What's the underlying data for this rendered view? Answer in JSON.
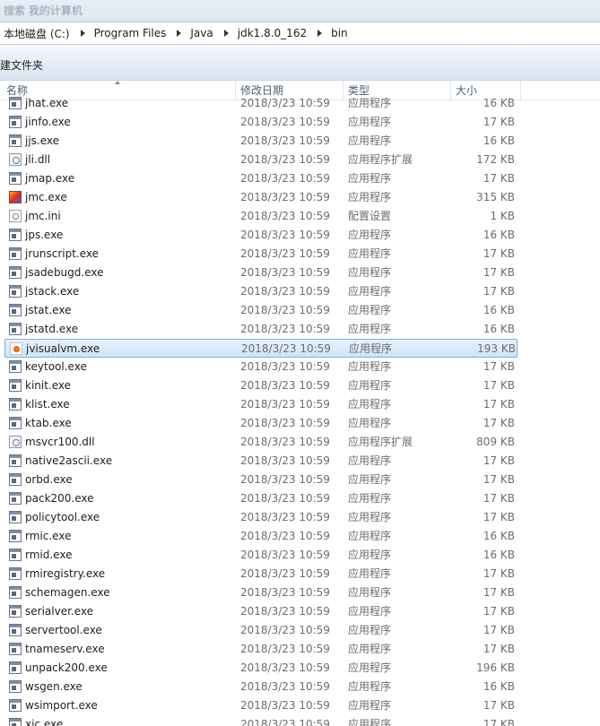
{
  "window": {
    "title_fragment": "搜索 我的计算机"
  },
  "address": {
    "crumbs": [
      "本地磁盘 (C:)",
      "Program Files",
      "Java",
      "jdk1.8.0_162",
      "bin"
    ]
  },
  "toolbar": {
    "new_folder_label": "新建文件夹"
  },
  "columns": {
    "name": "名称",
    "modified": "修改日期",
    "type": "类型",
    "size": "大小"
  },
  "files": [
    {
      "name": "jhat.exe",
      "date": "2018/3/23 10:59",
      "type": "应用程序",
      "size": "16 KB",
      "icon": "exe-icon"
    },
    {
      "name": "jinfo.exe",
      "date": "2018/3/23 10:59",
      "type": "应用程序",
      "size": "17 KB",
      "icon": "exe-icon"
    },
    {
      "name": "jjs.exe",
      "date": "2018/3/23 10:59",
      "type": "应用程序",
      "size": "16 KB",
      "icon": "exe-icon"
    },
    {
      "name": "jli.dll",
      "date": "2018/3/23 10:59",
      "type": "应用程序扩展",
      "size": "172 KB",
      "icon": "dll-icon"
    },
    {
      "name": "jmap.exe",
      "date": "2018/3/23 10:59",
      "type": "应用程序",
      "size": "17 KB",
      "icon": "exe-icon"
    },
    {
      "name": "jmc.exe",
      "date": "2018/3/23 10:59",
      "type": "应用程序",
      "size": "315 KB",
      "icon": "jmc-icon"
    },
    {
      "name": "jmc.ini",
      "date": "2018/3/23 10:59",
      "type": "配置设置",
      "size": "1 KB",
      "icon": "ini-icon"
    },
    {
      "name": "jps.exe",
      "date": "2018/3/23 10:59",
      "type": "应用程序",
      "size": "16 KB",
      "icon": "exe-icon"
    },
    {
      "name": "jrunscript.exe",
      "date": "2018/3/23 10:59",
      "type": "应用程序",
      "size": "17 KB",
      "icon": "exe-icon"
    },
    {
      "name": "jsadebugd.exe",
      "date": "2018/3/23 10:59",
      "type": "应用程序",
      "size": "17 KB",
      "icon": "exe-icon"
    },
    {
      "name": "jstack.exe",
      "date": "2018/3/23 10:59",
      "type": "应用程序",
      "size": "17 KB",
      "icon": "exe-icon"
    },
    {
      "name": "jstat.exe",
      "date": "2018/3/23 10:59",
      "type": "应用程序",
      "size": "16 KB",
      "icon": "exe-icon"
    },
    {
      "name": "jstatd.exe",
      "date": "2018/3/23 10:59",
      "type": "应用程序",
      "size": "16 KB",
      "icon": "exe-icon"
    },
    {
      "name": "jvisualvm.exe",
      "date": "2018/3/23 10:59",
      "type": "应用程序",
      "size": "193 KB",
      "icon": "jvisualvm-icon",
      "selected": true
    },
    {
      "name": "keytool.exe",
      "date": "2018/3/23 10:59",
      "type": "应用程序",
      "size": "17 KB",
      "icon": "exe-icon"
    },
    {
      "name": "kinit.exe",
      "date": "2018/3/23 10:59",
      "type": "应用程序",
      "size": "17 KB",
      "icon": "exe-icon"
    },
    {
      "name": "klist.exe",
      "date": "2018/3/23 10:59",
      "type": "应用程序",
      "size": "17 KB",
      "icon": "exe-icon"
    },
    {
      "name": "ktab.exe",
      "date": "2018/3/23 10:59",
      "type": "应用程序",
      "size": "17 KB",
      "icon": "exe-icon"
    },
    {
      "name": "msvcr100.dll",
      "date": "2018/3/23 10:59",
      "type": "应用程序扩展",
      "size": "809 KB",
      "icon": "dll-icon"
    },
    {
      "name": "native2ascii.exe",
      "date": "2018/3/23 10:59",
      "type": "应用程序",
      "size": "17 KB",
      "icon": "exe-icon"
    },
    {
      "name": "orbd.exe",
      "date": "2018/3/23 10:59",
      "type": "应用程序",
      "size": "17 KB",
      "icon": "exe-icon"
    },
    {
      "name": "pack200.exe",
      "date": "2018/3/23 10:59",
      "type": "应用程序",
      "size": "17 KB",
      "icon": "exe-icon"
    },
    {
      "name": "policytool.exe",
      "date": "2018/3/23 10:59",
      "type": "应用程序",
      "size": "17 KB",
      "icon": "exe-icon"
    },
    {
      "name": "rmic.exe",
      "date": "2018/3/23 10:59",
      "type": "应用程序",
      "size": "16 KB",
      "icon": "exe-icon"
    },
    {
      "name": "rmid.exe",
      "date": "2018/3/23 10:59",
      "type": "应用程序",
      "size": "16 KB",
      "icon": "exe-icon"
    },
    {
      "name": "rmiregistry.exe",
      "date": "2018/3/23 10:59",
      "type": "应用程序",
      "size": "17 KB",
      "icon": "exe-icon"
    },
    {
      "name": "schemagen.exe",
      "date": "2018/3/23 10:59",
      "type": "应用程序",
      "size": "17 KB",
      "icon": "exe-icon"
    },
    {
      "name": "serialver.exe",
      "date": "2018/3/23 10:59",
      "type": "应用程序",
      "size": "17 KB",
      "icon": "exe-icon"
    },
    {
      "name": "servertool.exe",
      "date": "2018/3/23 10:59",
      "type": "应用程序",
      "size": "17 KB",
      "icon": "exe-icon"
    },
    {
      "name": "tnameserv.exe",
      "date": "2018/3/23 10:59",
      "type": "应用程序",
      "size": "17 KB",
      "icon": "exe-icon"
    },
    {
      "name": "unpack200.exe",
      "date": "2018/3/23 10:59",
      "type": "应用程序",
      "size": "196 KB",
      "icon": "exe-icon"
    },
    {
      "name": "wsgen.exe",
      "date": "2018/3/23 10:59",
      "type": "应用程序",
      "size": "16 KB",
      "icon": "exe-icon"
    },
    {
      "name": "wsimport.exe",
      "date": "2018/3/23 10:59",
      "type": "应用程序",
      "size": "17 KB",
      "icon": "exe-icon"
    },
    {
      "name": "xjc.exe",
      "date": "2018/3/23 10:59",
      "type": "应用程序",
      "size": "17 KB",
      "icon": "exe-icon"
    }
  ]
}
